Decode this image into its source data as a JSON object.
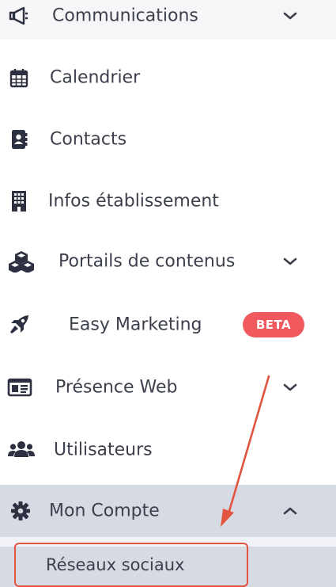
{
  "menu": {
    "items": [
      {
        "label": "Communications",
        "icon": "megaphone-icon",
        "expandable": true
      },
      {
        "label": "Calendrier",
        "icon": "calendar-icon"
      },
      {
        "label": "Contacts",
        "icon": "address-book-icon"
      },
      {
        "label": "Infos établissement",
        "icon": "building-icon"
      },
      {
        "label": "Portails de contenus",
        "icon": "cubes-icon",
        "expandable": true
      },
      {
        "label": "Easy Marketing",
        "icon": "rocket-icon",
        "badge": "BETA"
      },
      {
        "label": "Présence Web",
        "icon": "id-card-icon",
        "expandable": true
      },
      {
        "label": "Utilisateurs",
        "icon": "users-icon"
      },
      {
        "label": "Mon Compte",
        "icon": "gear-icon",
        "expanded": true
      }
    ],
    "submenu": [
      {
        "label": "Réseaux sociaux"
      }
    ]
  },
  "colors": {
    "text": "#3c3f4c",
    "active_bg": "#d6dae3",
    "beta_badge": "#f05a5f",
    "annotation_red": "#e2543f"
  }
}
